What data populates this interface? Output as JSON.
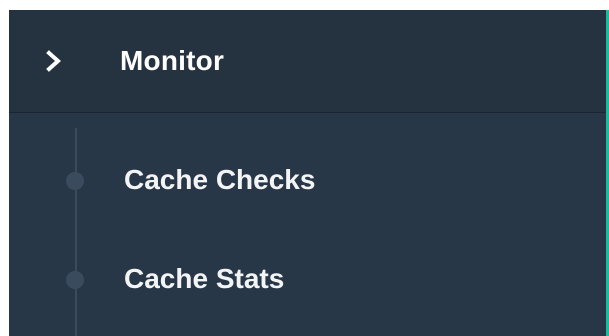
{
  "sidebar": {
    "section": {
      "label": "Monitor",
      "icon": "chevron-right-icon",
      "expanded": true
    },
    "items": [
      {
        "label": "Cache Checks"
      },
      {
        "label": "Cache Stats"
      }
    ]
  },
  "colors": {
    "background": "#283747",
    "header_background": "#25323f",
    "accent": "#1abc9c",
    "tree_line": "#3a4b5e",
    "text": "#ffffff"
  }
}
